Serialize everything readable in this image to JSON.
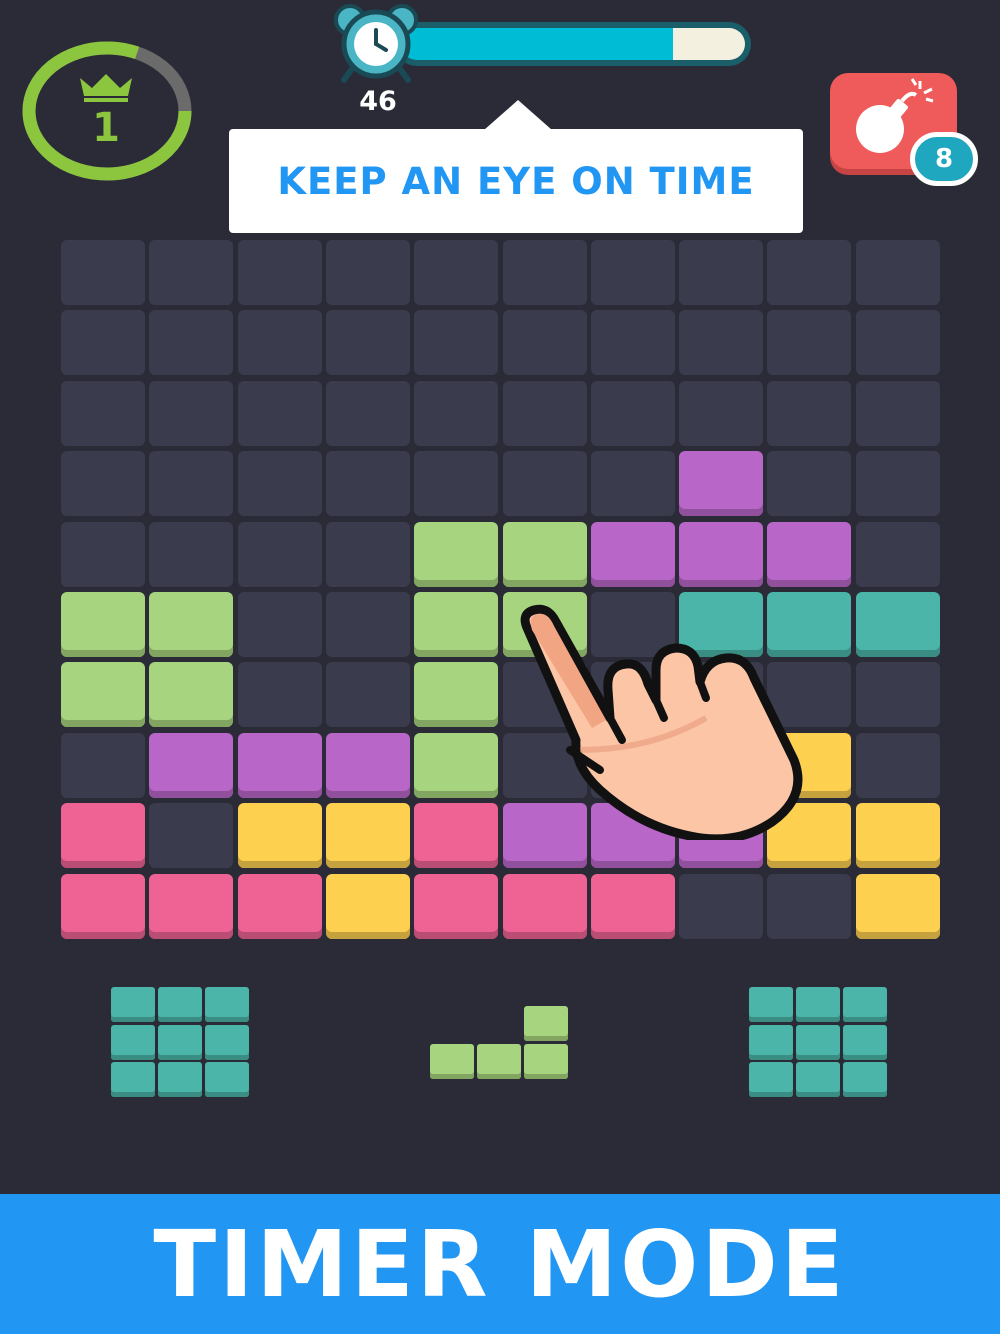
{
  "level": {
    "value": "1",
    "progress": 0.82
  },
  "timer": {
    "seconds": "46",
    "progress": 0.79
  },
  "tooltip": {
    "text": "KEEP AN EYE ON TIME"
  },
  "bomb": {
    "count": "8"
  },
  "colors": {
    "empty": "#3a3c4e",
    "green": "#a7d47e",
    "purple": "#b866c7",
    "teal": "#4ab5a8",
    "yellow": "#fdd04f",
    "pink": "#ef6394",
    "accent": "#2196f3"
  },
  "board": {
    "rows": [
      [
        "e",
        "e",
        "e",
        "e",
        "e",
        "e",
        "e",
        "e",
        "e",
        "e"
      ],
      [
        "e",
        "e",
        "e",
        "e",
        "e",
        "e",
        "e",
        "e",
        "e",
        "e"
      ],
      [
        "e",
        "e",
        "e",
        "e",
        "e",
        "e",
        "e",
        "e",
        "e",
        "e"
      ],
      [
        "e",
        "e",
        "e",
        "e",
        "e",
        "e",
        "e",
        "p",
        "e",
        "e"
      ],
      [
        "e",
        "e",
        "e",
        "e",
        "g",
        "g",
        "p",
        "p",
        "p",
        "e"
      ],
      [
        "g",
        "g",
        "e",
        "e",
        "g",
        "g",
        "e",
        "t",
        "t",
        "t"
      ],
      [
        "g",
        "g",
        "e",
        "e",
        "g",
        "e",
        "e",
        "e",
        "e",
        "e"
      ],
      [
        "e",
        "p",
        "p",
        "p",
        "g",
        "e",
        "e",
        "e",
        "y",
        "e"
      ],
      [
        "k",
        "e",
        "y",
        "y",
        "k",
        "p",
        "p",
        "p",
        "y",
        "y"
      ],
      [
        "k",
        "k",
        "k",
        "y",
        "k",
        "k",
        "k",
        "e",
        "e",
        "y"
      ]
    ]
  },
  "pieces": [
    {
      "name": "piece-left-square",
      "color": "teal",
      "shape": [
        [
          1,
          1,
          1
        ],
        [
          1,
          1,
          1
        ],
        [
          1,
          1,
          1
        ]
      ]
    },
    {
      "name": "piece-center-l",
      "color": "green",
      "shape": [
        [
          0,
          0,
          1
        ],
        [
          1,
          1,
          1
        ]
      ]
    },
    {
      "name": "piece-right-square",
      "color": "teal",
      "shape": [
        [
          1,
          1,
          1
        ],
        [
          1,
          1,
          1
        ],
        [
          1,
          1,
          1
        ]
      ]
    }
  ],
  "footer": {
    "title": "TIMER MODE"
  }
}
